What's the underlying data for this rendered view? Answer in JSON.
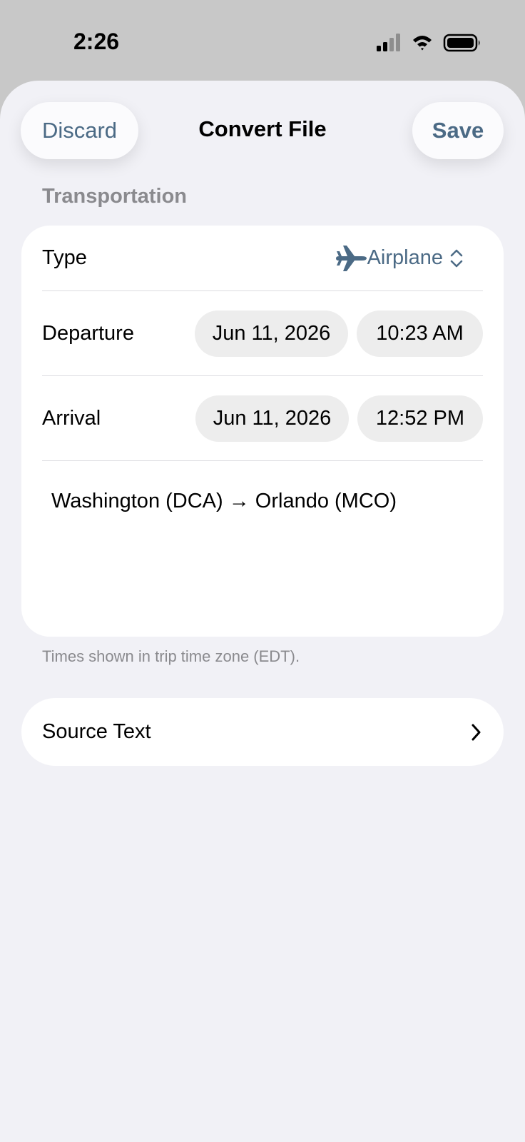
{
  "status_bar": {
    "time": "2:26",
    "icons": [
      "cellular-signal-icon",
      "wifi-icon",
      "battery-icon"
    ]
  },
  "nav": {
    "discard_label": "Discard",
    "title": "Convert File",
    "save_label": "Save"
  },
  "section": {
    "header": "Transportation"
  },
  "form": {
    "type_label": "Type",
    "type_value": "Airplane",
    "type_icon": "airplane-icon",
    "departure_label": "Departure",
    "departure_date": "Jun 11, 2026",
    "departure_time": "10:23 AM",
    "arrival_label": "Arrival",
    "arrival_date": "Jun 11, 2026",
    "arrival_time": "12:52 PM",
    "route": "Washington (DCA) → Orlando (MCO)"
  },
  "footnote": "Times shown in trip time zone (EDT).",
  "source": {
    "label": "Source Text"
  },
  "colors": {
    "accent": "#4b6a85",
    "background": "#f1f1f6",
    "card": "#ffffff",
    "secondary_text": "#8a8a8e"
  }
}
